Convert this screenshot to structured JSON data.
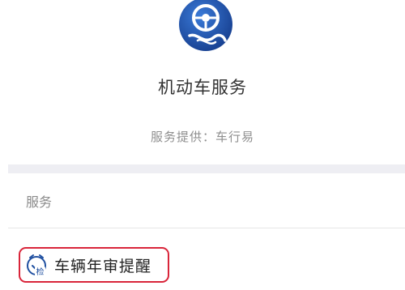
{
  "app": {
    "title": "机动车服务",
    "provider": "服务提供：车行易",
    "logo_icon": "steering-wheel-logo-icon"
  },
  "services": {
    "section_label": "服务",
    "items": [
      {
        "label": "车辆年审提醒",
        "icon": "inspection-reminder-icon",
        "icon_text": "检"
      }
    ]
  },
  "colors": {
    "brand_blue": "#1f4fa0",
    "highlight_red": "#d9253a"
  }
}
